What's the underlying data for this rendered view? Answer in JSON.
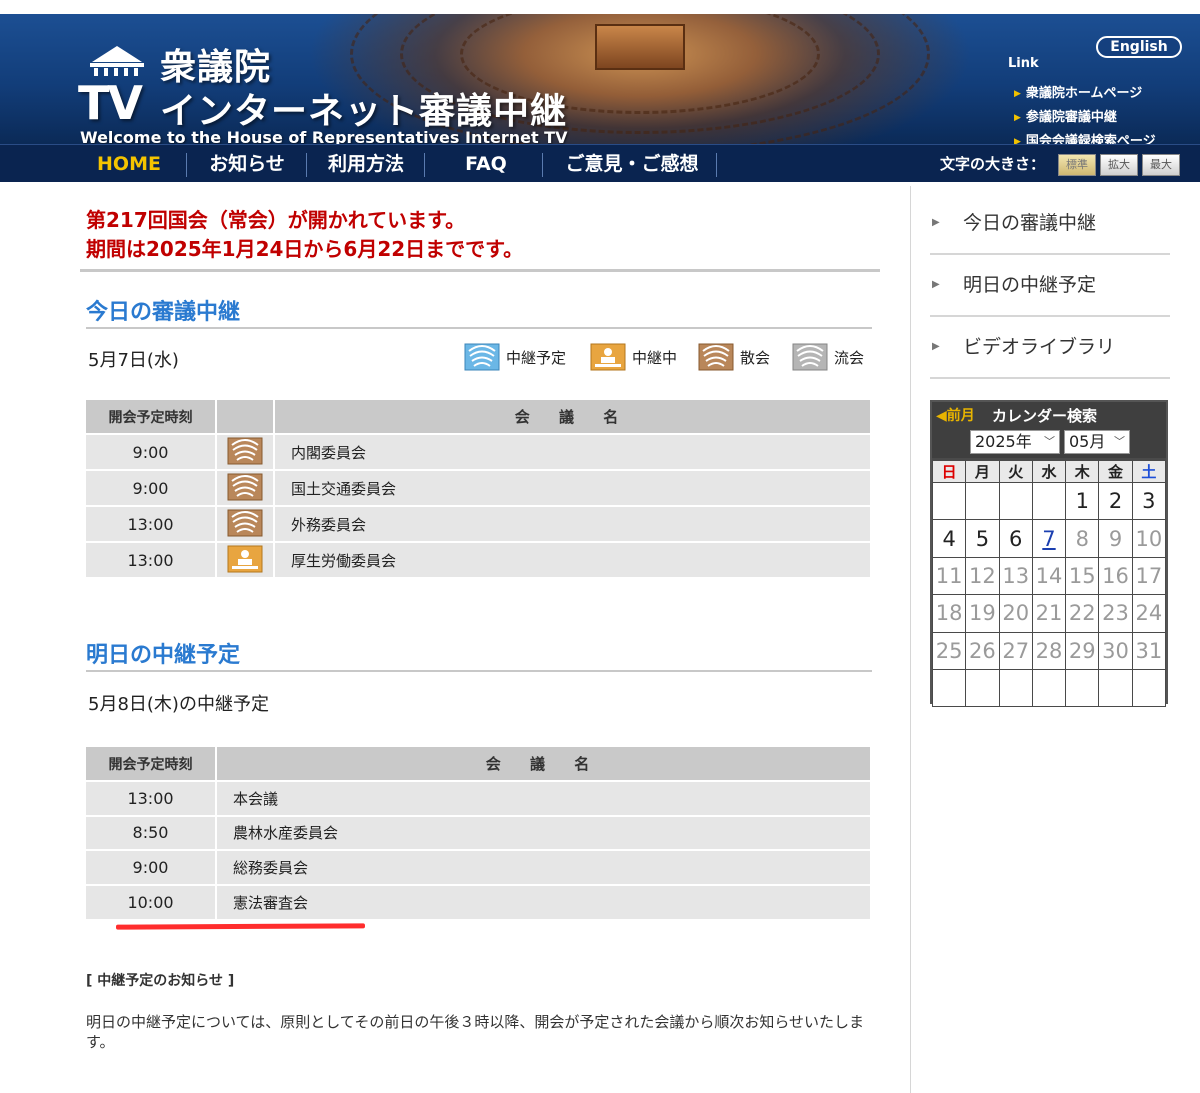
{
  "header": {
    "logo_tv": "TV",
    "logo_name": "衆議院",
    "logo_sub": "インターネット審議中継",
    "welcome": "Welcome to the House of Representatives Internet TV",
    "english_button": "English",
    "link_title": "Link",
    "links": [
      "衆議院ホームページ",
      "参議院審議中継",
      "国会会議録検索ページ"
    ]
  },
  "nav": {
    "items": [
      "HOME",
      "お知らせ",
      "利用方法",
      "FAQ",
      "ご意見・ご感想"
    ],
    "active": "HOME",
    "font_size_label": "文字の大きさ：",
    "font_size_options": [
      "標準",
      "拡大",
      "最大"
    ],
    "font_size_selected": "標準"
  },
  "notice": {
    "line1": "第217回国会（常会）が開かれています。",
    "line2": "期間は2025年1月24日から6月22日までです。"
  },
  "today": {
    "title": "今日の審議中継",
    "date": "5月7日(水)",
    "legend": [
      "中継予定",
      "中継中",
      "散会",
      "流会"
    ],
    "col_time": "開会予定時刻",
    "col_name": "会 議 名",
    "rows": [
      {
        "time": "9:00",
        "status": "散会",
        "name": "内閣委員会"
      },
      {
        "time": "9:00",
        "status": "散会",
        "name": "国土交通委員会"
      },
      {
        "time": "13:00",
        "status": "散会",
        "name": "外務委員会"
      },
      {
        "time": "13:00",
        "status": "中継中",
        "name": "厚生労働委員会"
      }
    ]
  },
  "tomorrow": {
    "title": "明日の中継予定",
    "date": "5月8日(木)の中継予定",
    "col_time": "開会予定時刻",
    "col_name": "会 議 名",
    "rows": [
      {
        "time": "13:00",
        "name": "本会議"
      },
      {
        "time": "8:50",
        "name": "農林水産委員会"
      },
      {
        "time": "9:00",
        "name": "総務委員会"
      },
      {
        "time": "10:00",
        "name": "憲法審査会"
      }
    ]
  },
  "schedule_notice": {
    "title": "[ 中継予定のお知らせ ]",
    "body": "明日の中継予定については、原則としてその前日の午後３時以降、開会が予定された会議から順次お知らせいたします。"
  },
  "sidebar": {
    "links": [
      "今日の審議中継",
      "明日の中継予定",
      "ビデオライブラリ"
    ]
  },
  "calendar": {
    "prev_label": "◀前月",
    "title": "カレンダー検索",
    "year": "2025年",
    "month": "05月",
    "weekdays": [
      "日",
      "月",
      "火",
      "水",
      "木",
      "金",
      "土"
    ],
    "weeks": [
      [
        "",
        "",
        "",
        "",
        "1",
        "2",
        "3"
      ],
      [
        "4",
        "5",
        "6",
        "7",
        "8",
        "9",
        "10"
      ],
      [
        "11",
        "12",
        "13",
        "14",
        "15",
        "16",
        "17"
      ],
      [
        "18",
        "19",
        "20",
        "21",
        "22",
        "23",
        "24"
      ],
      [
        "25",
        "26",
        "27",
        "28",
        "29",
        "30",
        "31"
      ],
      [
        "",
        "",
        "",
        "",
        "",
        "",
        ""
      ]
    ],
    "today": "7"
  },
  "colors": {
    "header_blue": "#123d79",
    "nav_bg": "#0a2450",
    "nav_active": "#f4c400",
    "notice_red": "#c00000",
    "section_blue": "#2a7ad0",
    "status_planned": "#6bb7e6",
    "status_live": "#e8a540",
    "status_adjourned": "#b9875a",
    "status_cancelled": "#b5b5b5"
  },
  "icons": {
    "planned": "chamber-planned-icon",
    "live": "chamber-live-icon",
    "adjourned": "chamber-adjourned-icon",
    "cancelled": "chamber-cancelled-icon"
  }
}
